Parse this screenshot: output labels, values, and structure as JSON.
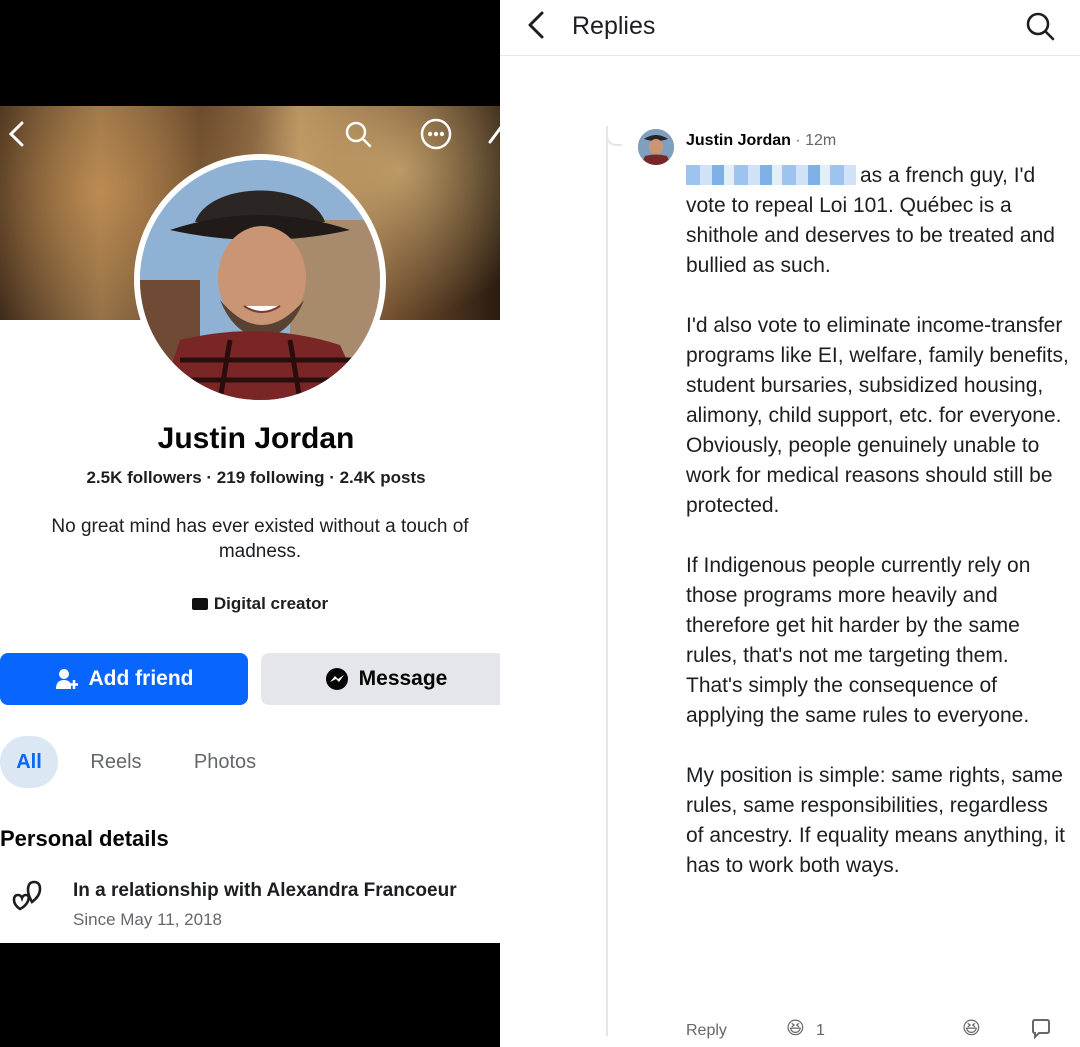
{
  "profile": {
    "name": "Justin Jordan",
    "stats": "2.5K followers · 219 following · 2.4K posts",
    "bio": "No great mind has ever existed without a touch of madness.",
    "category": "Digital creator",
    "add_friend_label": "Add friend",
    "message_label": "Message",
    "tabs": [
      {
        "label": "All",
        "active": true
      },
      {
        "label": "Reels",
        "active": false
      },
      {
        "label": "Photos",
        "active": false
      }
    ],
    "personal_details_title": "Personal details",
    "relationship": {
      "text": "In a relationship with Alexandra Francoeur",
      "since": "Since May 11, 2018"
    }
  },
  "replies": {
    "title": "Replies",
    "comment": {
      "author": "Justin Jordan",
      "time": "· 12m",
      "paragraphs": [
        "as a french guy, I'd vote to repeal Loi 101. Québec is a shithole and deserves to be treated and bullied as such.",
        "I'd also vote to eliminate income-transfer programs like EI, welfare, family benefits, student bursaries, subsidized housing, alimony, child support, etc. for everyone. Obviously, people genuinely unable to work for medical reasons should still be protected.",
        "If Indigenous people currently rely on those programs more heavily and therefore get hit harder by the same rules, that's not me targeting them. That's simply the consequence of applying the same rules to everyone.",
        "My position is simple: same rights, same rules, same responsibilities, regardless of ancestry. If equality means anything, it has to work both ways."
      ],
      "reply_label": "Reply",
      "reaction_count": "1"
    }
  },
  "colors": {
    "facebook_blue": "#0866ff",
    "secondary_button": "#e4e6eb",
    "muted_text": "#65676b"
  }
}
